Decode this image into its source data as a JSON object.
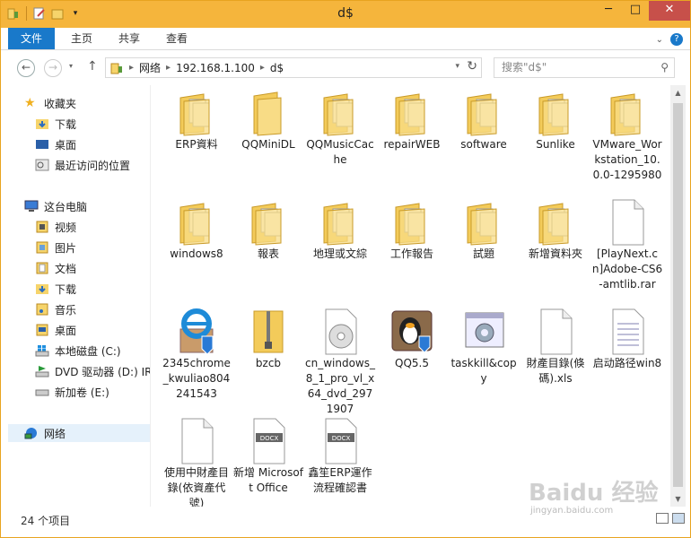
{
  "window": {
    "title": "d$",
    "minimize": "─",
    "maximize": "□",
    "close": "✕"
  },
  "ribbon": {
    "tabs": [
      "文件",
      "主页",
      "共享",
      "查看"
    ],
    "expand_icon": "chevron-down-icon",
    "help_icon": "help-icon"
  },
  "address": {
    "back": "←",
    "forward": "→",
    "up": "↑",
    "crumbs": [
      "网络",
      "192.168.1.100",
      "d$"
    ],
    "refresh": "↻",
    "search_placeholder": "搜索\"d$\""
  },
  "nav": {
    "favorites": "收藏夹",
    "fav_items": [
      "下载",
      "桌面",
      "最近访问的位置"
    ],
    "this_pc": "这台电脑",
    "pc_items": [
      "视频",
      "图片",
      "文档",
      "下载",
      "音乐",
      "桌面",
      "本地磁盘 (C:)",
      "DVD 驱动器 (D:) IR",
      "新加卷 (E:)"
    ],
    "network": "网络"
  },
  "files": [
    {
      "name": "ERP資料",
      "icon": "folder-docs-icon"
    },
    {
      "name": "QQMiniDL",
      "icon": "folder-icon"
    },
    {
      "name": "QQMusicCache",
      "icon": "folder-docs-icon"
    },
    {
      "name": "repairWEB",
      "icon": "folder-docs-icon"
    },
    {
      "name": "software",
      "icon": "folder-docs-icon"
    },
    {
      "name": "Sunlike",
      "icon": "folder-docs-icon"
    },
    {
      "name": "VMware_Workstation_10.0.0-1295980",
      "icon": "folder-docs-icon"
    },
    {
      "name": "windows8",
      "icon": "folder-docs-icon"
    },
    {
      "name": "報表",
      "icon": "folder-docs-icon"
    },
    {
      "name": "地理或文綜",
      "icon": "folder-docs-icon"
    },
    {
      "name": "工作報告",
      "icon": "folder-docs-icon"
    },
    {
      "name": "試題",
      "icon": "folder-docs-icon"
    },
    {
      "name": "新增資料夾",
      "icon": "folder-docs-icon"
    },
    {
      "name": "[PlayNext.cn]Adobe-CS6-amtlib.rar",
      "icon": "file-icon"
    },
    {
      "name": "2345chrome_kwuliao804241543",
      "icon": "ie-installer-icon"
    },
    {
      "name": "bzcb",
      "icon": "zip-folder-icon"
    },
    {
      "name": "cn_windows_8_1_pro_vl_x64_dvd_2971907",
      "icon": "disc-icon"
    },
    {
      "name": "QQ5.5",
      "icon": "qq-penguin-icon"
    },
    {
      "name": "taskkill&copy",
      "icon": "batch-gear-icon"
    },
    {
      "name": "財產目錄(倏碼).xls",
      "icon": "file-icon"
    },
    {
      "name": "启动路径win8",
      "icon": "text-file-icon"
    },
    {
      "name": "使用中財產目錄(依資產代號)",
      "icon": "file-icon"
    },
    {
      "name": "新增 Microsoft Office",
      "icon": "docx-icon"
    },
    {
      "name": "鑫笙ERP運作流程確認書",
      "icon": "docx-icon"
    }
  ],
  "status": {
    "count": "24 个项目"
  },
  "watermark": {
    "brand": "Baidu 经验",
    "url": "jingyan.baidu.com"
  },
  "colors": {
    "titlebar": "#f5b53c",
    "file_tab": "#1979ca",
    "close": "#c7504a",
    "folder": "#f6d46b"
  }
}
